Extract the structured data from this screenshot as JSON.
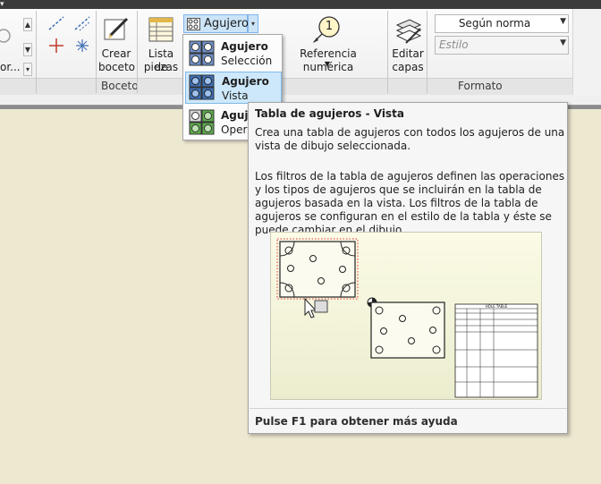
{
  "ribbon": {
    "group_boceto": "Boceto",
    "group_formato": "Formato",
    "partial_left_label": "or...",
    "crear_boceto_line1": "Crear",
    "crear_boceto_line2": "boceto",
    "lista_piezas_line1": "Lista de",
    "lista_piezas_line2": "piezas",
    "agujero_label": "Agujero",
    "referencia_label": "Referencia numérica",
    "referencia_number": "1",
    "editar_capas_line1": "Editar",
    "editar_capas_line2": "capas",
    "style_combo_value": "Según norma",
    "estilo_combo_placeholder": "Estilo"
  },
  "dropdown": {
    "items": [
      {
        "title": "Agujero",
        "subtitle": "Selección"
      },
      {
        "title": "Agujero",
        "subtitle": "Vista"
      },
      {
        "title": "Agujero",
        "subtitle": "Opera"
      }
    ]
  },
  "tooltip": {
    "title": "Tabla de agujeros - Vista",
    "para1": "Crea una tabla de agujeros con todos los agujeros de una vista de dibujo seleccionada.",
    "para2": "Los filtros de la tabla de agujeros definen las operaciones y los tipos de agujeros que se incluirán en la tabla de agujeros basada en la vista. Los filtros de la tabla de agujeros se configuran en el estilo de la tabla y éste se puede cambiar en el dibujo.",
    "footer": "Pulse F1 para obtener más ayuda",
    "illustration_table_title": "HOLE TABLE"
  },
  "colors": {
    "hover_blue": "#cde8fb",
    "hover_border": "#7fb8e6",
    "canvas": "#ede8d0",
    "icon_blue": "#3d6fb4",
    "icon_green": "#5caa4a"
  }
}
